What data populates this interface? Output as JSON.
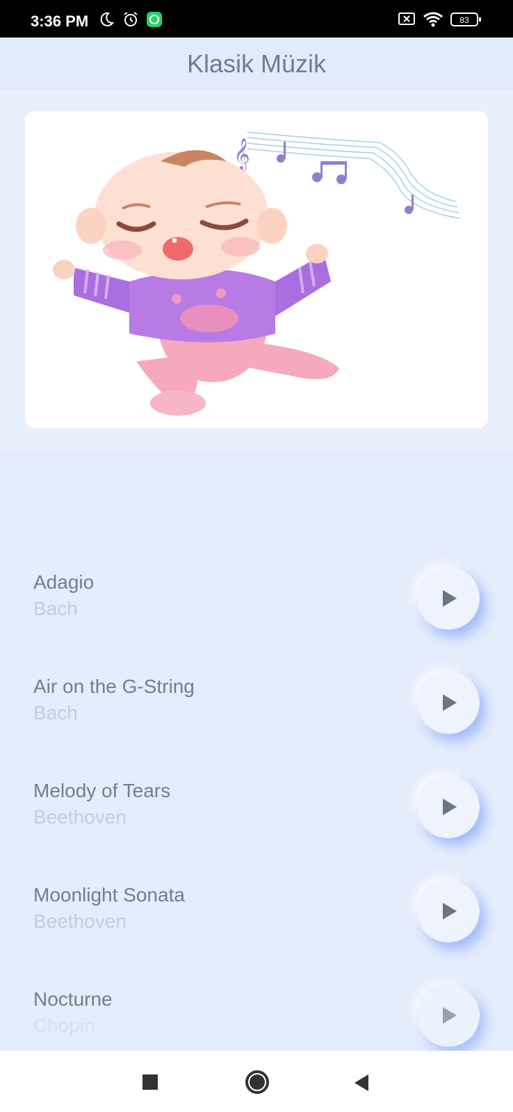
{
  "status_bar": {
    "time": "3:36 PM",
    "battery": "83",
    "icons": [
      "moon-icon",
      "alarm-icon",
      "whatsapp-icon",
      "no-sim-icon",
      "wifi-icon",
      "battery-icon"
    ]
  },
  "app_bar": {
    "title": "Klasik Müzik"
  },
  "hero": {
    "image": "singing-baby-illustration"
  },
  "songs": [
    {
      "title": "Adagio",
      "artist": "Bach"
    },
    {
      "title": "Air on the G-String",
      "artist": "Bach"
    },
    {
      "title": "Melody of Tears",
      "artist": "Beethoven"
    },
    {
      "title": "Moonlight Sonata",
      "artist": "Beethoven"
    },
    {
      "title": "Nocturne",
      "artist": "Chopin"
    }
  ],
  "colors": {
    "background": "#e3edfb",
    "title": "#6c7d95",
    "song_title": "#6f7e93",
    "song_artist": "#c2cede",
    "play_glow": "#6688ff"
  },
  "nav_bar": {
    "icons": [
      "recents-icon",
      "home-icon",
      "back-icon"
    ]
  }
}
